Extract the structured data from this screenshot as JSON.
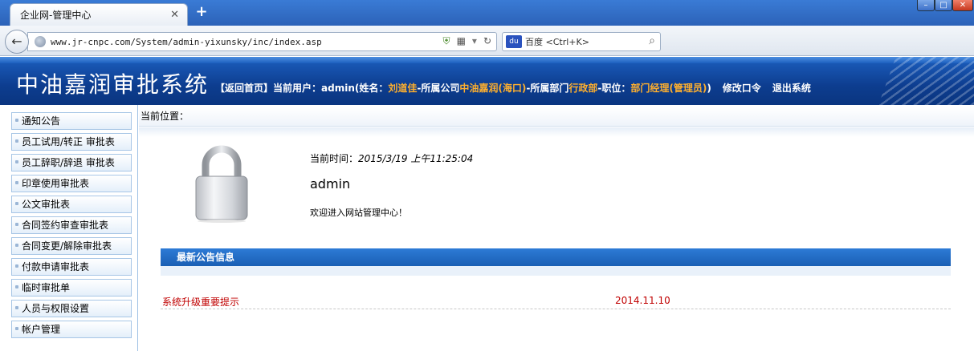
{
  "browser": {
    "tab_title": "企业网-管理中心",
    "new_tab": "+",
    "url": "www.jr-cnpc.com/System/admin-yixunsky/inc/index.asp",
    "search_engine": "百度",
    "search_placeholder": "百度 <Ctrl+K>"
  },
  "header": {
    "app_title": "中油嘉润审批系统",
    "back_home": "【返回首页】",
    "current_user_prefix": "当前用户：admin(姓名：",
    "user_name": "刘道佳",
    "company_prefix": "-所属公司",
    "company": "中油嘉润(海口)",
    "dept_prefix": "-所属部门",
    "dept": "行政部",
    "position_prefix": "-职位：",
    "position": "部门经理(管理员)",
    "close_paren": ")",
    "change_password": "修改口令",
    "logout": "退出系统"
  },
  "sidebar": {
    "items": [
      {
        "label": "通知公告"
      },
      {
        "label": "员工试用/转正 审批表"
      },
      {
        "label": "员工辞职/辞退 审批表"
      },
      {
        "label": "印章使用审批表"
      },
      {
        "label": "公文审批表"
      },
      {
        "label": "合同签约审查审批表"
      },
      {
        "label": "合同变更/解除审批表"
      },
      {
        "label": "付款申请审批表"
      },
      {
        "label": "临时审批单"
      },
      {
        "label": "人员与权限设置"
      },
      {
        "label": "帐户管理"
      }
    ]
  },
  "main": {
    "breadcrumb": "当前位置：",
    "time_label": "当前时间：",
    "time_value": "2015/3/19 上午11:25:04",
    "admin_name": "admin",
    "welcome": "欢迎进入网站管理中心！",
    "notice_header": "最新公告信息",
    "notices": [
      {
        "title": "系统升级重要提示",
        "date": "2014.11.10"
      }
    ]
  },
  "colors": {
    "header_blue": "#0d3d8f",
    "highlight_orange": "#ffb02e",
    "notice_red": "#c00000"
  }
}
